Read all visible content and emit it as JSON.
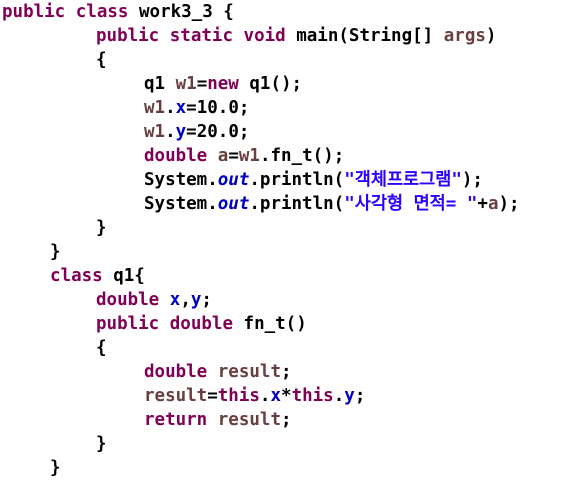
{
  "colors": {
    "background": "#ffffff",
    "keyword": "#7f0055",
    "field": "#0000c0",
    "local_variable": "#6a3e3e",
    "string": "#2a00ff",
    "default": "#000000"
  },
  "code": {
    "l1": {
      "t1": "public",
      "t2": "class",
      "t3": "work3_3 {"
    },
    "l2": {
      "t1": "public",
      "t2": "static",
      "t3": "void",
      "t4": "main(String[] ",
      "t5": "args",
      "t6": ")"
    },
    "l3": {
      "t1": "{"
    },
    "l4": {
      "t1": "q1 ",
      "t2": "w1",
      "t3": "=",
      "t4": "new",
      "t5": " q1();"
    },
    "l5": {
      "t1": "w1",
      "t2": ".",
      "t3": "x",
      "t4": "=10.0;"
    },
    "l6": {
      "t1": "w1",
      "t2": ".",
      "t3": "y",
      "t4": "=20.0;"
    },
    "l7": {
      "t1": "double",
      "t2": "a",
      "t3": "=",
      "t4": "w1",
      "t5": ".fn_t();"
    },
    "l8": {
      "t1": "System.",
      "t2": "out",
      "t3": ".println(",
      "t4": "\"객체프로그램\"",
      "t5": ");"
    },
    "l9": {
      "t1": "System.",
      "t2": "out",
      "t3": ".println(",
      "t4": "\"사각형 면적= \"",
      "t5": "+",
      "t6": "a",
      "t7": ");"
    },
    "l10": {
      "t1": "}"
    },
    "l11": {
      "t1": "}"
    },
    "l12": {
      "t1": "class",
      "t2": "q1{"
    },
    "l13": {
      "t1": "double",
      "t2": "x",
      "t3": ",",
      "t4": "y",
      "t5": ";"
    },
    "l14": {
      "t1": "public",
      "t2": "double",
      "t3": "fn_t()"
    },
    "l15": {
      "t1": "{"
    },
    "l16": {
      "t1": "double",
      "t2": "result",
      "t3": ";"
    },
    "l17": {
      "t1": "result",
      "t2": "=",
      "t3": "this",
      "t4": ".",
      "t5": "x",
      "t6": "*",
      "t7": "this",
      "t8": ".",
      "t9": "y",
      "t10": ";"
    },
    "l18": {
      "t1": "return",
      "t2": "result",
      "t3": ";"
    },
    "l19": {
      "t1": "}"
    },
    "l20": {
      "t1": "}"
    }
  }
}
